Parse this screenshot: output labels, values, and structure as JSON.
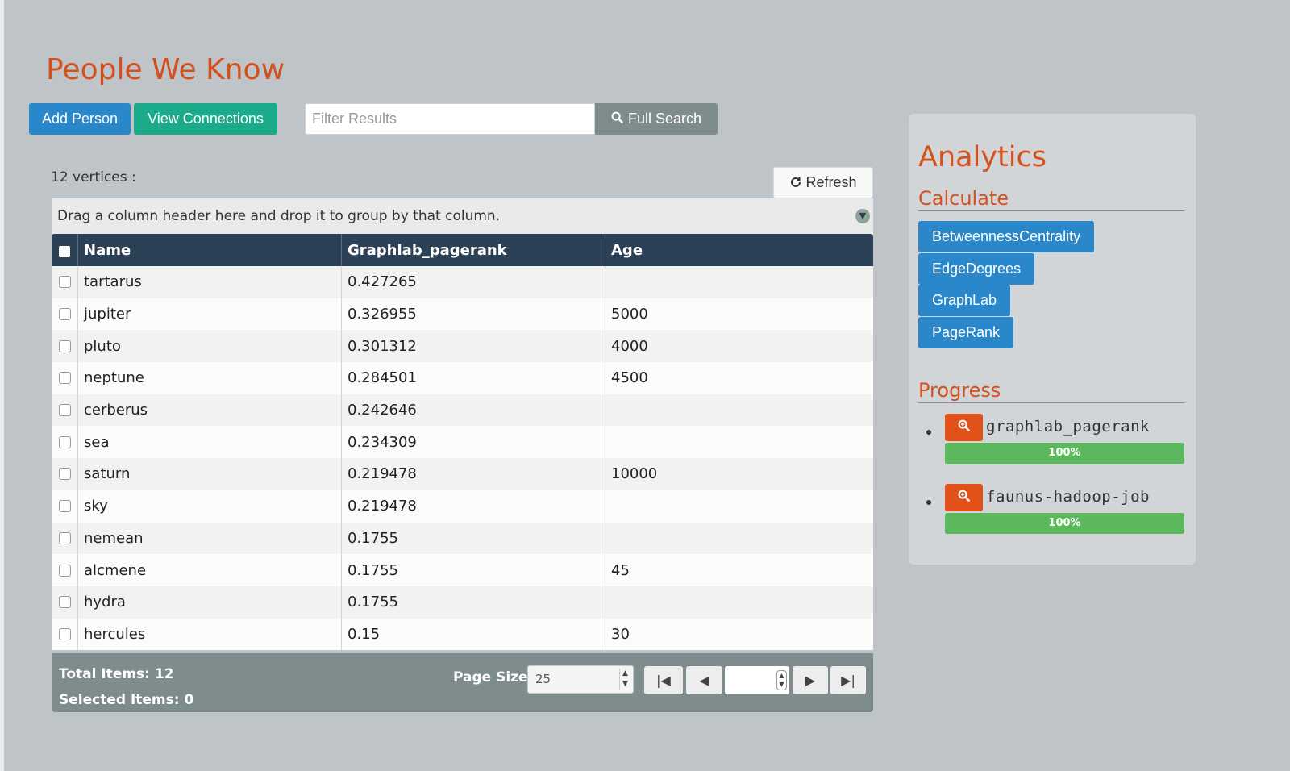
{
  "header": {
    "title": "People We Know"
  },
  "toolbar": {
    "add_person": "Add Person",
    "view_connections": "View Connections",
    "filter_placeholder": "Filter Results",
    "full_search": "Full Search"
  },
  "grid": {
    "vertex_count": "12 vertices :",
    "refresh": "Refresh",
    "group_hint": "Drag a column header here and drop it to group by that column.",
    "columns": [
      "Name",
      "Graphlab_pagerank",
      "Age"
    ],
    "rows": [
      {
        "name": "tartarus",
        "rank": "0.427265",
        "age": ""
      },
      {
        "name": "jupiter",
        "rank": "0.326955",
        "age": "5000"
      },
      {
        "name": "pluto",
        "rank": "0.301312",
        "age": "4000"
      },
      {
        "name": "neptune",
        "rank": "0.284501",
        "age": "4500"
      },
      {
        "name": "cerberus",
        "rank": "0.242646",
        "age": ""
      },
      {
        "name": "sea",
        "rank": "0.234309",
        "age": ""
      },
      {
        "name": "saturn",
        "rank": "0.219478",
        "age": "10000"
      },
      {
        "name": "sky",
        "rank": "0.219478",
        "age": ""
      },
      {
        "name": "nemean",
        "rank": "0.1755",
        "age": ""
      },
      {
        "name": "alcmene",
        "rank": "0.1755",
        "age": "45"
      },
      {
        "name": "hydra",
        "rank": "0.1755",
        "age": ""
      },
      {
        "name": "hercules",
        "rank": "0.15",
        "age": "30"
      }
    ],
    "footer": {
      "total_items": "Total Items: 12",
      "selected_items": "Selected Items: 0",
      "page_size_label": "Page Size:",
      "page_size_value": "25"
    }
  },
  "analytics": {
    "title": "Analytics",
    "calculate_title": "Calculate",
    "calculate_buttons": [
      "BetweennessCentrality",
      "EdgeDegrees",
      "GraphLab",
      "PageRank"
    ],
    "progress_title": "Progress",
    "jobs": [
      {
        "name": "graphlab_pagerank",
        "progress": 100,
        "progress_label": "100%"
      },
      {
        "name": "faunus-hadoop-job",
        "progress": 100,
        "progress_label": "100%"
      }
    ]
  },
  "colors": {
    "accent_orange": "#d4511e",
    "primary_blue": "#2a87c9",
    "success_green": "#1bab8a",
    "header_dark": "#2d4156"
  },
  "icons": {
    "search": "search-icon",
    "refresh": "refresh-icon",
    "zoom": "zoom-in-icon"
  }
}
